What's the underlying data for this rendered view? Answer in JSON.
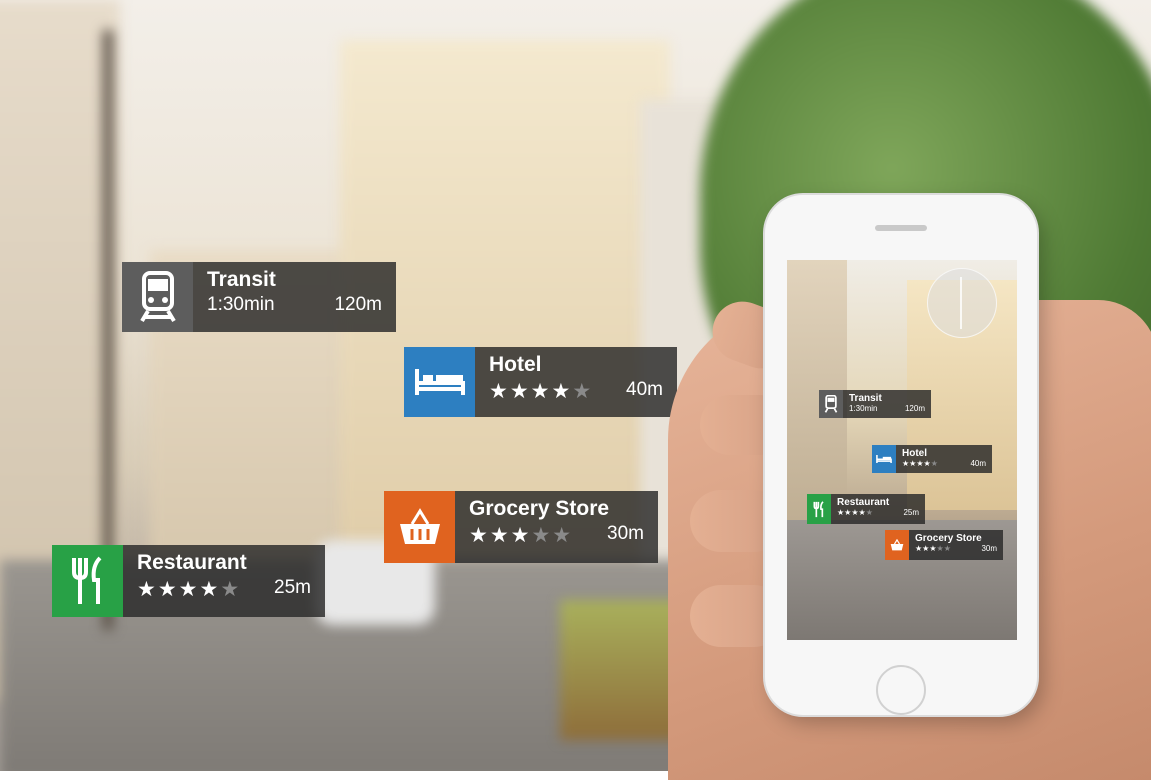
{
  "colors": {
    "transit": "#5d5d5d",
    "hotel": "#2d7fc1",
    "grocery": "#e0631f",
    "restaurant": "#28a146",
    "panel": "#2a2a2a"
  },
  "markers": {
    "transit": {
      "icon": "train-icon",
      "title": "Transit",
      "time": "1:30min",
      "distance": "120m"
    },
    "hotel": {
      "icon": "bed-icon",
      "title": "Hotel",
      "rating": 4,
      "max_rating": 5,
      "distance": "40m"
    },
    "grocery": {
      "icon": "basket-icon",
      "title": "Grocery Store",
      "rating": 3,
      "max_rating": 5,
      "distance": "30m"
    },
    "restaurant": {
      "icon": "fork-knife-icon",
      "title": "Restaurant",
      "rating": 4,
      "max_rating": 5,
      "distance": "25m"
    }
  },
  "phone_markers": {
    "transit": {
      "title": "Transit",
      "time": "1:30min",
      "distance": "120m"
    },
    "hotel": {
      "title": "Hotel",
      "rating": 4,
      "max_rating": 5,
      "distance": "40m"
    },
    "restaurant": {
      "title": "Restaurant",
      "rating": 4,
      "max_rating": 5,
      "distance": "25m"
    },
    "grocery": {
      "title": "Grocery Store",
      "rating": 3,
      "max_rating": 5,
      "distance": "30m"
    }
  },
  "phone": {
    "compass_icon": "compass-icon"
  }
}
